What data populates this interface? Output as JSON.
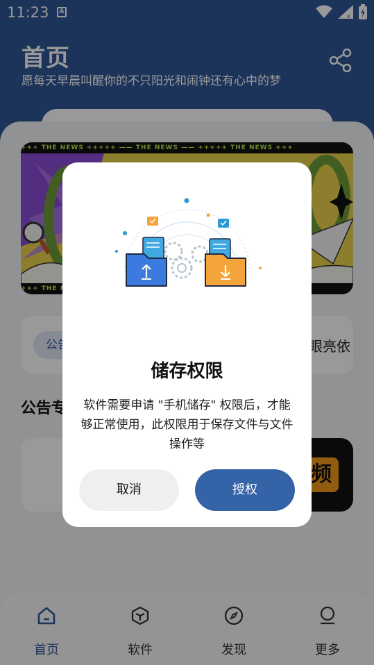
{
  "status_bar": {
    "time": "11:23",
    "a_badge": "A"
  },
  "header": {
    "title": "首页",
    "subtitle": "愿每天早晨叫醒你的不只阳光和闹钟还有心中的梦",
    "share_icon": "share-icon"
  },
  "banner": {
    "strip_text": "+++ THE NEWS +++++ —— THE NEWS —— +++++ THE NEWS +++"
  },
  "notice": {
    "tag_label": "公告",
    "text": "眼亮依"
  },
  "section": {
    "title": "公告专"
  },
  "app_card": {
    "icon_glyph": "频"
  },
  "dialog": {
    "title": "储存权限",
    "message": "软件需要申请 \"手机储存\" 权限后，才能够正常使用，此权限用于保存文件与文件操作等",
    "cancel_label": "取消",
    "grant_label": "授权"
  },
  "bottom_nav": {
    "items": [
      {
        "label": "首页",
        "icon": "home-icon",
        "active": true
      },
      {
        "label": "软件",
        "icon": "cube-icon",
        "active": false
      },
      {
        "label": "发现",
        "icon": "compass-icon",
        "active": false
      },
      {
        "label": "更多",
        "icon": "user-icon",
        "active": false
      }
    ]
  },
  "colors": {
    "primary": "#2f5596",
    "button_primary": "#3563a8",
    "accent_orange": "#f39a1a"
  }
}
